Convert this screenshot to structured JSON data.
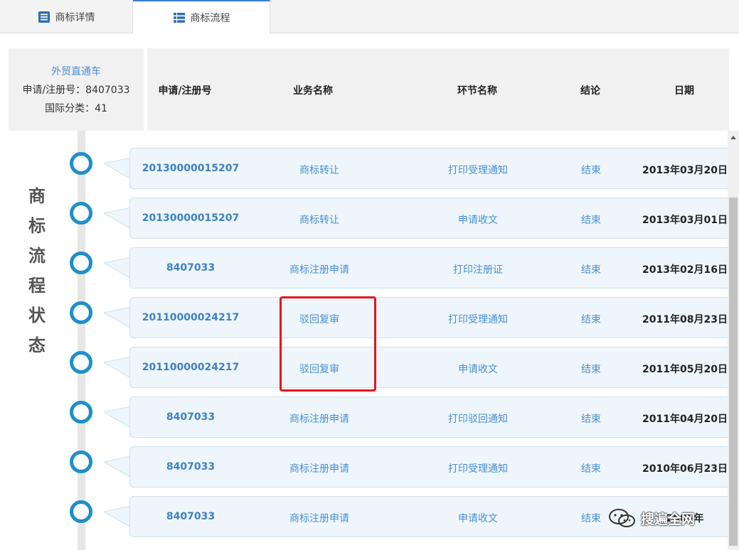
{
  "tabs": [
    {
      "label": "商标详情",
      "icon": "document-list-icon"
    },
    {
      "label": "商标流程",
      "icon": "table-list-icon"
    }
  ],
  "info": {
    "agent": "外贸直通车",
    "reg_no": "申请/注册号：8407033",
    "intl_class": "国际分类：41"
  },
  "headers": {
    "reg_no": "申请/注册号",
    "business": "业务名称",
    "step": "环节名称",
    "result": "结论",
    "date": "日期"
  },
  "side_title": [
    "商",
    "标",
    "流",
    "程",
    "状",
    "态"
  ],
  "rows": [
    {
      "no": "20130000015207",
      "biz": "商标转让",
      "step": "打印受理通知",
      "res": "结束",
      "date": "2013年03月20日"
    },
    {
      "no": "20130000015207",
      "biz": "商标转让",
      "step": "申请收文",
      "res": "结束",
      "date": "2013年03月01日"
    },
    {
      "no": "8407033",
      "biz": "商标注册申请",
      "step": "打印注册证",
      "res": "结束",
      "date": "2013年02月16日"
    },
    {
      "no": "20110000024217",
      "biz": "驳回复审",
      "step": "打印受理通知",
      "res": "结束",
      "date": "2011年08月23日"
    },
    {
      "no": "20110000024217",
      "biz": "驳回复审",
      "step": "申请收文",
      "res": "结束",
      "date": "2011年05月20日"
    },
    {
      "no": "8407033",
      "biz": "商标注册申请",
      "step": "打印驳回通知",
      "res": "结束",
      "date": "2011年04月20日"
    },
    {
      "no": "8407033",
      "biz": "商标注册申请",
      "step": "打印受理通知",
      "res": "结束",
      "date": "2010年06月23日"
    },
    {
      "no": "8407033",
      "biz": "商标注册申请",
      "step": "申请收文",
      "res": "结束",
      "date": "2009年"
    }
  ],
  "watermark": "搜遍全网",
  "colors": {
    "accent": "#1e8fc9",
    "link": "#4a8fd0",
    "highlight": "#e5141c",
    "row_bg": "#eef6fb"
  }
}
